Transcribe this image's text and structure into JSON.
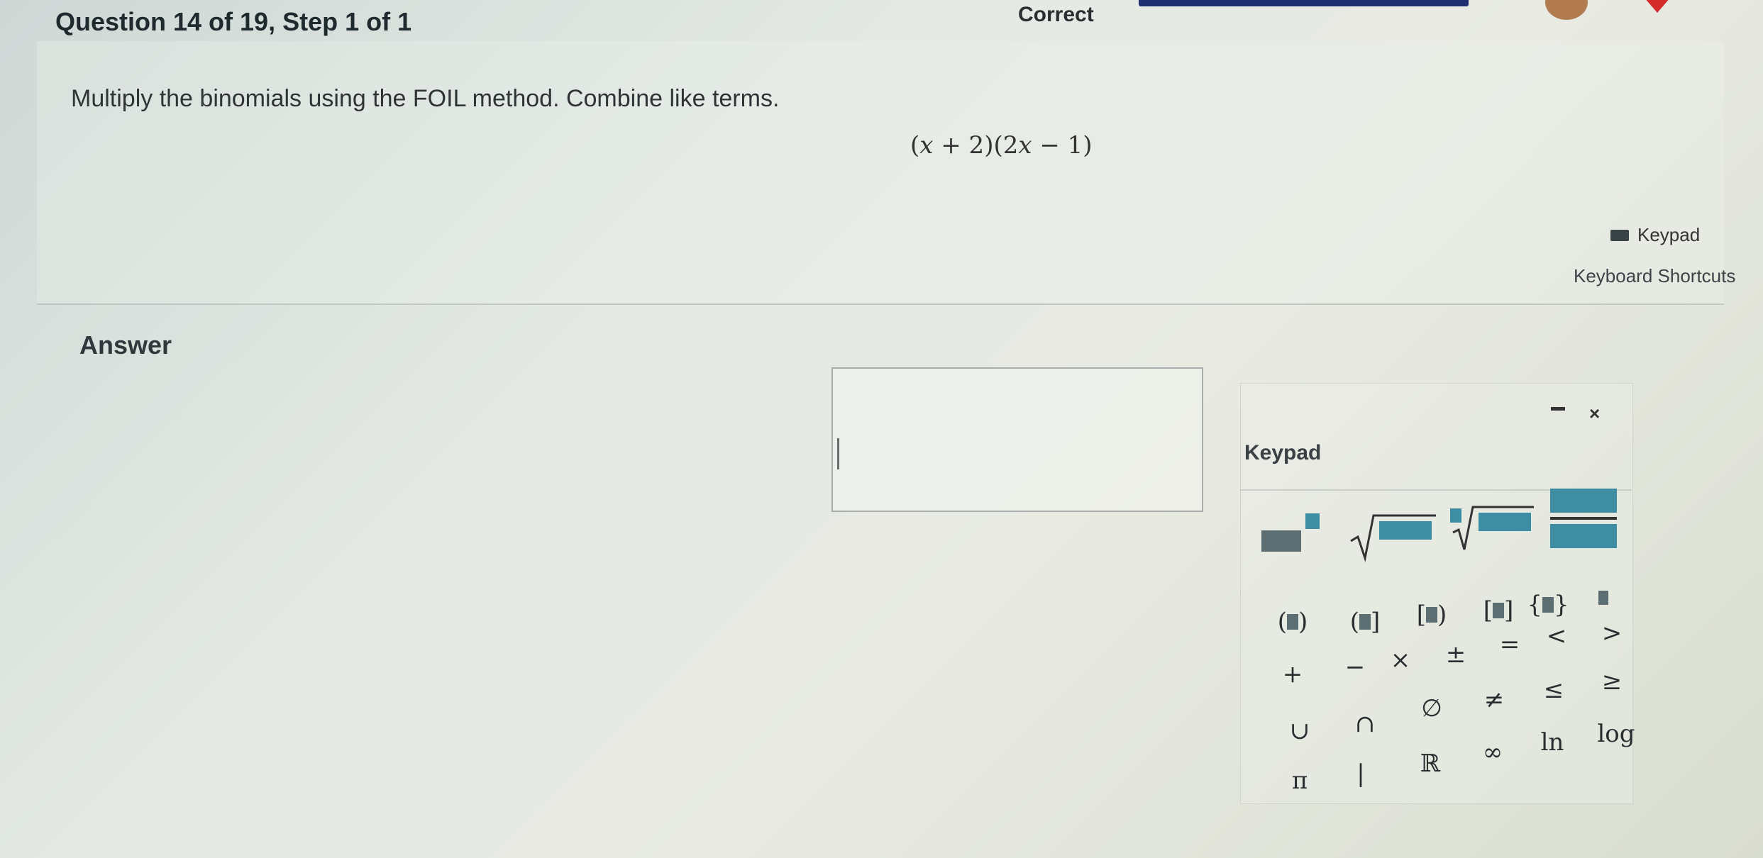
{
  "header": {
    "question_label": "Question 14 of 19, Step 1 of 1",
    "status": "Correct"
  },
  "question": {
    "instruction": "Multiply the binomials using the FOIL method. Combine like terms.",
    "expression_parts": [
      "(",
      "x",
      " + 2)(2",
      "x",
      " − 1)"
    ]
  },
  "tools": {
    "keypad_label": "Keypad",
    "shortcuts_label": "Keyboard Shortcuts"
  },
  "answer": {
    "label": "Answer",
    "value": ""
  },
  "keypad": {
    "title": "Keypad",
    "close_symbol": "×",
    "row_brackets": [
      {
        "open": "(",
        "close": ")"
      },
      {
        "open": "(",
        "close": "]"
      },
      {
        "open": "[",
        "close": ")"
      },
      {
        "open": "[",
        "close": "]"
      },
      {
        "open": "{",
        "close": "}"
      }
    ],
    "row_ops": [
      "+",
      "−",
      "×",
      "±",
      "=",
      "<",
      ">"
    ],
    "row_sets": [
      "∪",
      "∩",
      "∅",
      "≠",
      "≤",
      "≥"
    ],
    "row_consts": [
      "π",
      "|",
      "ℝ",
      "∞",
      "ln",
      "log"
    ]
  },
  "colors": {
    "progress": "#1f2e6e",
    "keypad_placeholder": "#3d8ea3",
    "heart": "#d42b2b"
  }
}
